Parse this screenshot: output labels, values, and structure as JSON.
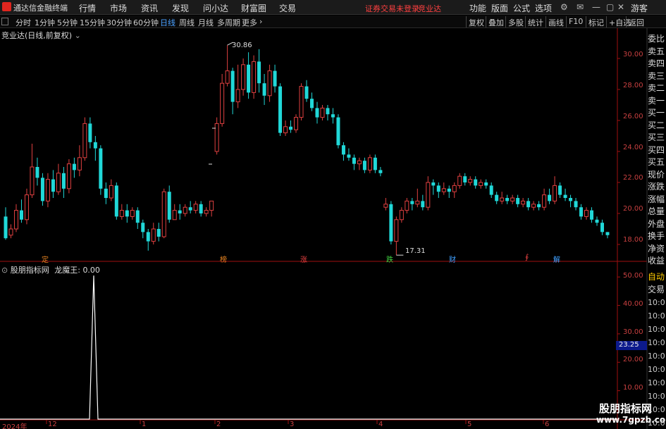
{
  "topbar": {
    "app_title": "通达信金融终端",
    "menus": [
      "行情",
      "市场",
      "资讯",
      "发现",
      "问小达",
      "财富圈",
      "交易"
    ],
    "notice": "证券交易未登录",
    "stock_name": "竞业达",
    "right_menus": [
      "功能",
      "版面",
      "公式",
      "选项"
    ],
    "guest": "游客"
  },
  "periodbar": {
    "periods": [
      "分时",
      "1分钟",
      "5分钟",
      "15分钟",
      "30分钟",
      "60分钟",
      "日线",
      "周线",
      "月线",
      "多周期",
      "更多"
    ],
    "active": "日线",
    "tools": [
      "复权",
      "叠加",
      "多股",
      "统计",
      "画线",
      "F10",
      "标记",
      "+自选",
      "返回"
    ]
  },
  "main_chart": {
    "title": "竞业达(日线,前复权)",
    "high_label": "30.86",
    "low_label": "17.31",
    "y_ticks": [
      "30.00",
      "28.00",
      "26.00",
      "24.00",
      "22.00",
      "20.00",
      "18.00"
    ],
    "events": [
      {
        "text": "定",
        "color": "#e08020"
      },
      {
        "text": "榜",
        "color": "#e08020"
      },
      {
        "text": "涨",
        "color": "#e04040"
      },
      {
        "text": "跌",
        "color": "#40d040"
      },
      {
        "text": "财",
        "color": "#40a0ff"
      },
      {
        "text": "∮",
        "color": "#e04040"
      },
      {
        "text": "解",
        "color": "#40a0ff"
      }
    ]
  },
  "indicator": {
    "title": "股朋指标网",
    "name": "龙魔王",
    "value": "0.00",
    "y_ticks": [
      "50.00",
      "40.00",
      "30.00",
      "20.00",
      "10.00"
    ],
    "current": "23.25"
  },
  "x_axis": [
    "2024年",
    "12",
    "1",
    "2",
    "3",
    "4",
    "5",
    "6"
  ],
  "right_panel": {
    "labels": [
      "委比",
      "卖五",
      "卖四",
      "卖三",
      "卖二",
      "卖一",
      "买一",
      "买二",
      "买三",
      "买四",
      "买五",
      "现价",
      "涨跌",
      "涨幅",
      "总量",
      "外盘",
      "换手",
      "净资",
      "收益"
    ],
    "auto": "自动",
    "trade": "交易",
    "ticks": [
      "10:0",
      "10:0",
      "10:0",
      "10:0",
      "10:0",
      "10:0",
      "10:0",
      "10:0",
      "10:0",
      "10:0"
    ]
  },
  "watermark": {
    "main": "股朋指标网",
    "sub": "www.7gpzb.com"
  },
  "colors": {
    "up": "#e04040",
    "down": "#20d8d8",
    "axis": "#a01010",
    "line": "#ffffff"
  },
  "icons": [
    "logo-icon",
    "settings-icon",
    "mail-icon",
    "minimize-icon",
    "maximize-icon",
    "close-icon"
  ],
  "chart_data": {
    "type": "candlestick",
    "ylim": [
      17.0,
      31.5
    ],
    "high": 30.86,
    "low": 17.31,
    "candles": [
      [
        19.8,
        18.4,
        20.4,
        18.3
      ],
      [
        18.6,
        19.0,
        19.3,
        18.4
      ],
      [
        19.0,
        20.2,
        20.6,
        18.8
      ],
      [
        20.2,
        19.6,
        20.9,
        19.4
      ],
      [
        19.6,
        21.2,
        21.6,
        19.3
      ],
      [
        21.2,
        23.0,
        24.5,
        21.0
      ],
      [
        23.0,
        22.3,
        23.6,
        21.8
      ],
      [
        22.3,
        20.8,
        22.6,
        20.5
      ],
      [
        20.8,
        22.2,
        22.6,
        20.4
      ],
      [
        22.2,
        21.4,
        22.8,
        21.0
      ],
      [
        21.4,
        22.6,
        23.2,
        21.2
      ],
      [
        22.6,
        21.6,
        23.0,
        21.0
      ],
      [
        21.6,
        23.2,
        23.5,
        21.3
      ],
      [
        23.2,
        22.8,
        23.6,
        22.3
      ],
      [
        22.8,
        23.6,
        24.4,
        22.4
      ],
      [
        23.6,
        25.8,
        26.2,
        23.4
      ],
      [
        25.8,
        24.6,
        26.2,
        24.2
      ],
      [
        24.6,
        24.2,
        25.0,
        23.4
      ],
      [
        24.2,
        21.6,
        24.4,
        21.2
      ],
      [
        21.6,
        21.0,
        22.0,
        20.6
      ],
      [
        21.0,
        21.8,
        22.2,
        20.8
      ],
      [
        21.8,
        19.8,
        22.0,
        19.6
      ],
      [
        19.8,
        20.2,
        20.6,
        19.6
      ],
      [
        20.2,
        19.8,
        20.6,
        19.4
      ],
      [
        19.8,
        20.2,
        20.4,
        19.6
      ],
      [
        20.2,
        19.4,
        20.4,
        19.0
      ],
      [
        19.4,
        18.8,
        19.6,
        18.4
      ],
      [
        18.8,
        18.2,
        19.0,
        17.6
      ],
      [
        18.2,
        19.0,
        19.4,
        18.0
      ],
      [
        19.0,
        18.5,
        19.4,
        18.2
      ],
      [
        18.5,
        21.4,
        21.6,
        18.4
      ],
      [
        21.4,
        19.6,
        21.8,
        19.4
      ],
      [
        19.6,
        20.2,
        20.6,
        19.6
      ],
      [
        20.2,
        20.0,
        20.6,
        19.6
      ],
      [
        20.0,
        20.4,
        20.6,
        19.8
      ],
      [
        20.4,
        20.2,
        20.8,
        20.0
      ],
      [
        20.2,
        20.6,
        20.8,
        20.0
      ],
      [
        20.6,
        20.0,
        20.8,
        19.8
      ],
      [
        20.0,
        20.2,
        20.4,
        19.8
      ],
      [
        20.2,
        20.8,
        20.8,
        19.8
      ],
      [
        24.0,
        25.8,
        26.2,
        23.8
      ],
      [
        25.8,
        28.4,
        29.0,
        25.6
      ],
      [
        28.4,
        29.2,
        30.86,
        28.2
      ],
      [
        29.2,
        27.2,
        29.4,
        26.4
      ],
      [
        27.2,
        28.0,
        29.6,
        26.8
      ],
      [
        28.0,
        29.6,
        30.0,
        27.6
      ],
      [
        29.6,
        27.8,
        30.4,
        27.4
      ],
      [
        27.8,
        29.8,
        30.2,
        27.4
      ],
      [
        29.8,
        28.4,
        30.6,
        27.8
      ],
      [
        28.4,
        27.6,
        29.0,
        27.0
      ],
      [
        27.6,
        29.2,
        29.6,
        27.2
      ],
      [
        29.2,
        28.2,
        29.6,
        27.8
      ],
      [
        28.2,
        25.2,
        28.4,
        25.0
      ],
      [
        25.2,
        25.6,
        26.0,
        25.0
      ],
      [
        25.6,
        25.4,
        26.0,
        25.2
      ],
      [
        25.4,
        26.2,
        26.4,
        25.2
      ],
      [
        26.2,
        28.2,
        28.4,
        26.0
      ],
      [
        28.2,
        27.4,
        28.6,
        27.2
      ],
      [
        27.4,
        26.8,
        27.8,
        26.6
      ],
      [
        26.8,
        26.2,
        27.2,
        25.8
      ],
      [
        26.2,
        26.8,
        27.0,
        26.0
      ],
      [
        26.8,
        26.4,
        27.0,
        26.0
      ],
      [
        26.4,
        26.2,
        26.8,
        25.8
      ],
      [
        26.2,
        24.4,
        26.4,
        24.2
      ],
      [
        24.4,
        23.8,
        24.6,
        23.4
      ],
      [
        23.8,
        23.6,
        24.2,
        23.4
      ],
      [
        23.6,
        23.2,
        23.8,
        22.8
      ],
      [
        23.2,
        23.4,
        23.6,
        22.8
      ],
      [
        23.4,
        22.8,
        23.6,
        22.6
      ],
      [
        22.8,
        23.6,
        23.8,
        22.6
      ],
      [
        23.6,
        22.8,
        23.8,
        22.6
      ],
      [
        22.8,
        22.6,
        23.0,
        22.4
      ],
      [
        20.4,
        20.6,
        21.0,
        20.2
      ],
      [
        20.6,
        18.2,
        20.8,
        18.0
      ],
      [
        18.2,
        19.6,
        19.8,
        17.31
      ],
      [
        19.6,
        20.2,
        20.4,
        19.4
      ],
      [
        20.2,
        20.8,
        21.0,
        20.0
      ],
      [
        20.8,
        20.6,
        21.0,
        20.2
      ],
      [
        20.6,
        20.8,
        21.6,
        20.4
      ],
      [
        20.8,
        20.4,
        21.2,
        20.2
      ],
      [
        20.4,
        22.0,
        22.4,
        20.2
      ],
      [
        22.0,
        21.8,
        22.2,
        21.2
      ],
      [
        21.8,
        21.4,
        22.0,
        21.0
      ],
      [
        21.4,
        21.6,
        22.0,
        21.2
      ],
      [
        21.6,
        21.4,
        21.8,
        21.0
      ],
      [
        21.4,
        21.8,
        22.0,
        21.0
      ],
      [
        21.8,
        22.4,
        22.6,
        21.6
      ],
      [
        22.4,
        22.0,
        22.6,
        21.8
      ],
      [
        22.0,
        22.2,
        22.4,
        21.8
      ],
      [
        22.2,
        21.8,
        22.4,
        21.6
      ],
      [
        21.8,
        22.0,
        22.2,
        21.6
      ],
      [
        22.0,
        21.8,
        22.2,
        21.6
      ],
      [
        21.8,
        21.2,
        22.0,
        21.0
      ],
      [
        21.2,
        20.8,
        21.4,
        20.6
      ],
      [
        20.8,
        21.0,
        21.4,
        20.6
      ],
      [
        21.0,
        20.8,
        21.2,
        20.6
      ],
      [
        20.8,
        21.0,
        21.2,
        20.6
      ],
      [
        21.0,
        20.6,
        21.2,
        20.4
      ],
      [
        20.6,
        20.8,
        21.0,
        20.4
      ],
      [
        20.8,
        20.4,
        21.0,
        20.2
      ],
      [
        20.4,
        20.6,
        20.8,
        20.2
      ],
      [
        20.6,
        20.4,
        20.8,
        20.2
      ],
      [
        20.4,
        21.2,
        21.6,
        20.2
      ],
      [
        21.2,
        20.8,
        21.6,
        20.6
      ],
      [
        20.8,
        21.8,
        22.4,
        20.6
      ],
      [
        21.8,
        21.2,
        22.0,
        21.0
      ],
      [
        21.2,
        21.0,
        21.6,
        20.8
      ],
      [
        21.0,
        20.8,
        21.2,
        20.4
      ],
      [
        20.8,
        20.4,
        21.0,
        20.2
      ],
      [
        20.4,
        19.8,
        20.6,
        19.6
      ],
      [
        19.8,
        20.2,
        20.4,
        19.6
      ],
      [
        20.2,
        19.6,
        20.4,
        19.4
      ],
      [
        19.6,
        19.4,
        19.8,
        19.2
      ],
      [
        19.4,
        18.8,
        19.6,
        18.6
      ],
      [
        18.8,
        18.6,
        18.8,
        18.4
      ]
    ],
    "indicator": {
      "name": "龙魔王",
      "ylim": [
        0,
        55
      ],
      "spike_index": 18,
      "spike_value": 50.5
    }
  }
}
